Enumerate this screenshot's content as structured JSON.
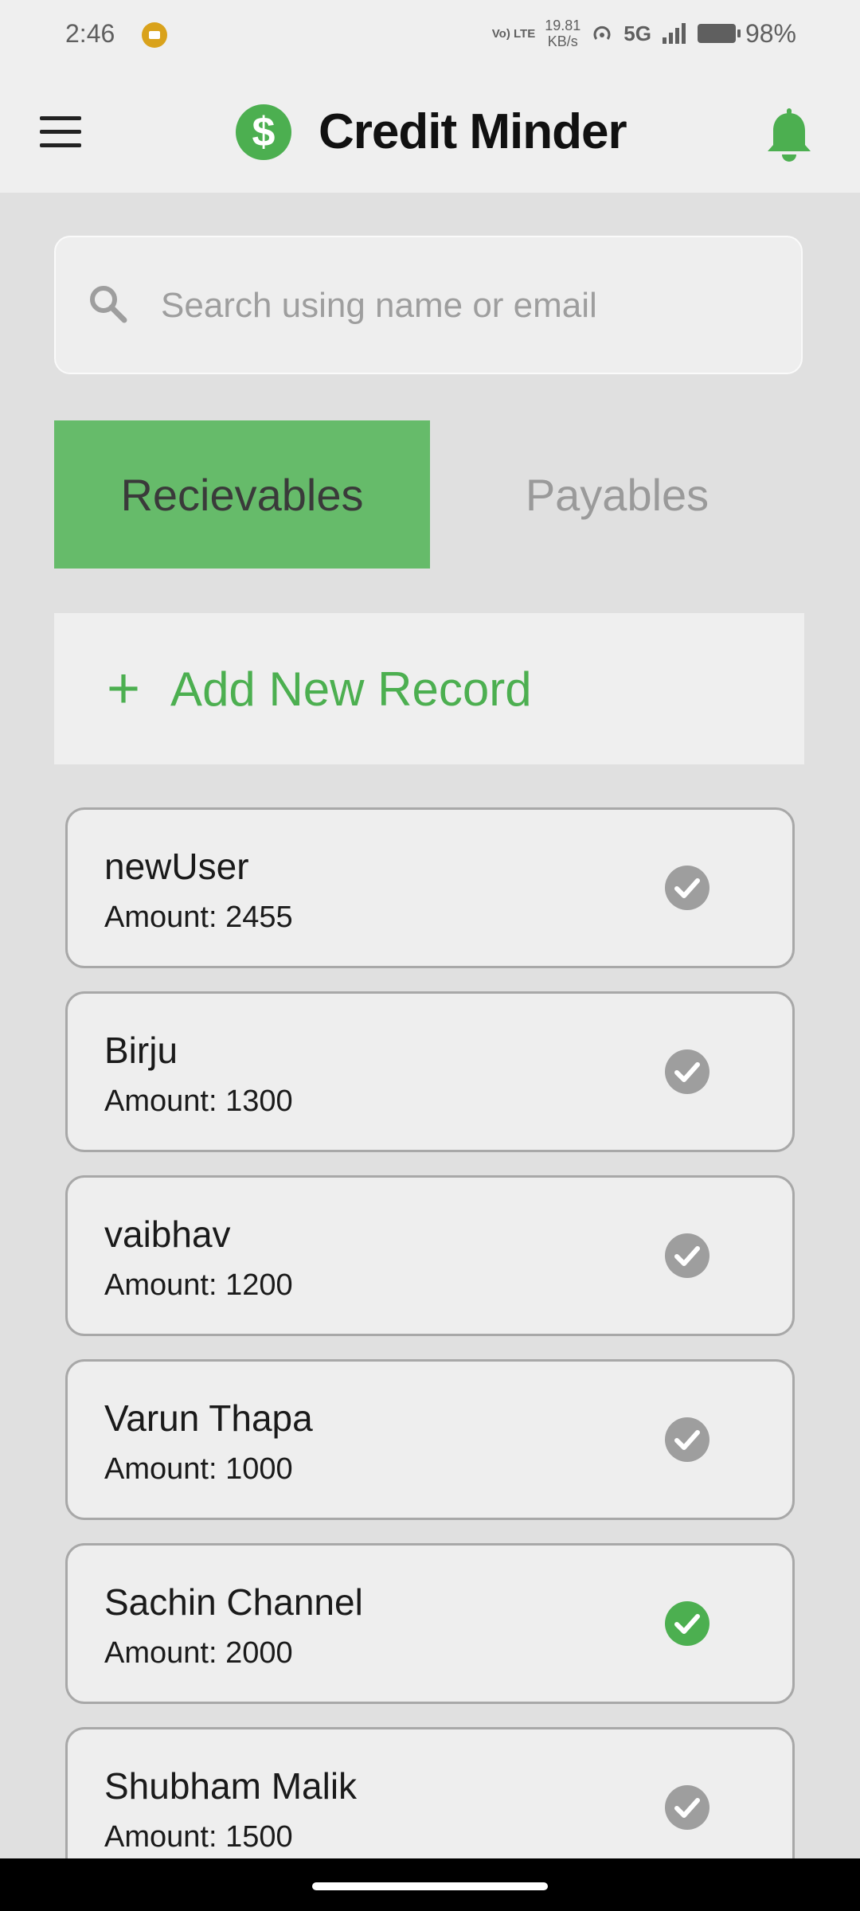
{
  "status_bar": {
    "time": "2:46",
    "volte": "Vo) LTE",
    "speed_value": "19.81",
    "speed_unit": "KB/s",
    "network": "5G",
    "battery": "98%"
  },
  "header": {
    "title": "Credit Minder",
    "logo_glyph": "$"
  },
  "search": {
    "placeholder": "Search using name or email",
    "value": ""
  },
  "tabs": [
    {
      "label": "Recievables",
      "active": true
    },
    {
      "label": "Payables",
      "active": false
    }
  ],
  "add_record": {
    "icon": "+",
    "label": "Add New Record"
  },
  "records": [
    {
      "name": "newUser",
      "amount": "Amount: 2455",
      "settled": false
    },
    {
      "name": "Birju",
      "amount": "Amount: 1300",
      "settled": false
    },
    {
      "name": "vaibhav",
      "amount": "Amount: 1200",
      "settled": false
    },
    {
      "name": "Varun Thapa",
      "amount": "Amount: 1000",
      "settled": false
    },
    {
      "name": "Sachin Channel",
      "amount": "Amount: 2000",
      "settled": true
    },
    {
      "name": "Shubham Malik",
      "amount": "Amount: 1500",
      "settled": false
    }
  ],
  "colors": {
    "accent": "#4caf50",
    "tab_active": "#66bb6a",
    "check_inactive": "#9e9e9e",
    "check_active": "#4caf50",
    "background": "#e0e0e0"
  }
}
